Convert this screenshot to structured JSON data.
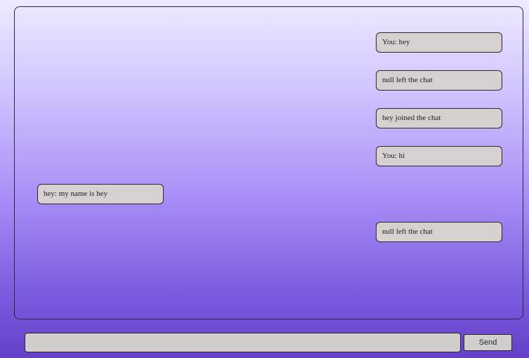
{
  "chat": {
    "messages": [
      {
        "text": "You: hey",
        "side": "right"
      },
      {
        "text": "null left the chat",
        "side": "right"
      },
      {
        "text": "hey joined the chat",
        "side": "right"
      },
      {
        "text": "You: hi",
        "side": "right"
      },
      {
        "text": "hey: my name is hey",
        "side": "left"
      },
      {
        "text": "null left the chat",
        "side": "right"
      }
    ]
  },
  "composer": {
    "value": "",
    "placeholder": "",
    "send_label": "Send"
  }
}
